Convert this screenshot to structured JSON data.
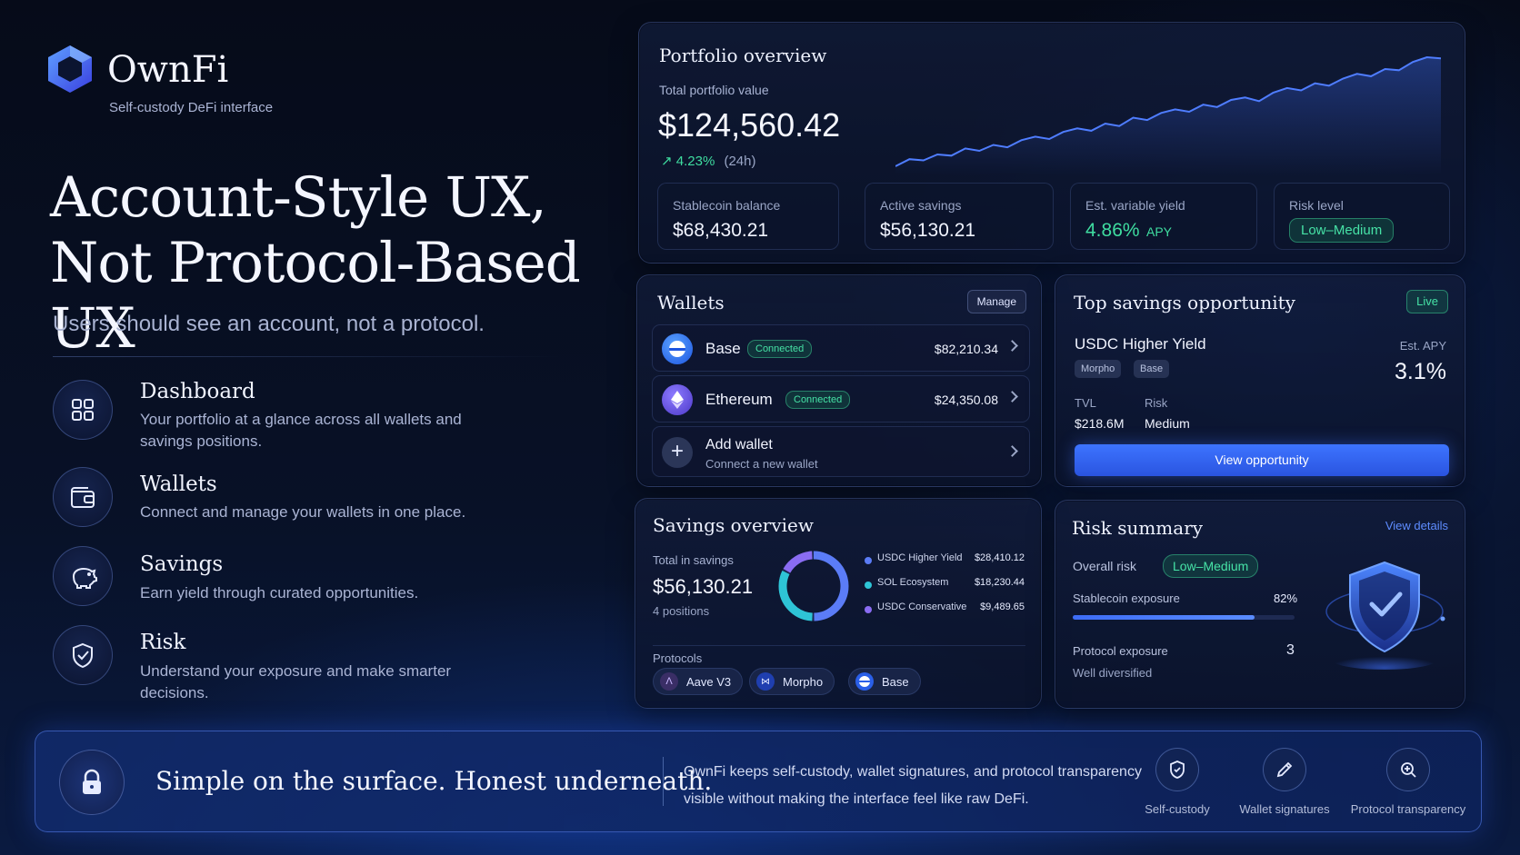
{
  "brand": {
    "name": "OwnFi",
    "subtitle": "Self-custody DeFi interface",
    "icon": "hexagon-logo-icon",
    "accent": "#3d6cf5"
  },
  "hero": {
    "headline_line1": "Account-Style UX,",
    "headline_line2": "Not Protocol-Based UX",
    "tagline": "Users should see an account, not a protocol."
  },
  "features": [
    {
      "title": "Dashboard",
      "desc": "Your portfolio at a glance across all wallets and savings positions.",
      "icon": "grid-icon"
    },
    {
      "title": "Wallets",
      "desc": "Connect and manage your wallets in one place.",
      "icon": "wallet-icon"
    },
    {
      "title": "Savings",
      "desc": "Earn yield through curated opportunities.",
      "icon": "piggy-bank-icon"
    },
    {
      "title": "Risk",
      "desc": "Understand your exposure and make smarter decisions.",
      "icon": "shield-check-icon"
    }
  ],
  "portfolio": {
    "title": "Portfolio overview",
    "total_label": "Total portfolio value",
    "total_value": "$124,560.42",
    "change": "4.23%",
    "change_period": "(24h)",
    "stats": [
      {
        "label": "Stablecoin balance",
        "value": "$68,430.21"
      },
      {
        "label": "Active savings",
        "value": "$56,130.21"
      },
      {
        "label": "Est. variable yield",
        "value": "4.86%",
        "unit": "APY"
      },
      {
        "label": "Risk level",
        "value": "Low–Medium"
      }
    ],
    "sparkline": [
      4,
      10,
      9,
      14,
      13,
      19,
      17,
      22,
      20,
      26,
      29,
      27,
      33,
      36,
      34,
      40,
      38,
      45,
      43,
      49,
      52,
      50,
      56,
      54,
      60,
      62,
      59,
      66,
      70,
      68,
      74,
      72,
      78,
      82,
      80,
      86,
      85,
      92,
      96,
      95
    ]
  },
  "wallets": {
    "title": "Wallets",
    "manage_label": "Manage",
    "items": [
      {
        "name": "Base",
        "status": "Connected",
        "balance": "$82,210.34",
        "icon": "base-logo-icon"
      },
      {
        "name": "Ethereum",
        "status": "Connected",
        "balance": "$24,350.08",
        "icon": "ethereum-logo-icon"
      }
    ],
    "add": {
      "title": "Add wallet",
      "subtitle": "Connect a new wallet",
      "icon": "plus-icon"
    }
  },
  "opportunity": {
    "title": "Top savings opportunity",
    "badge": "Live",
    "name": "USDC Higher Yield",
    "tags": [
      "Morpho",
      "Base"
    ],
    "apy_label": "Est. APY",
    "apy_value": "3.1%",
    "tvl_label": "TVL",
    "tvl_value": "$218.6M",
    "risk_label": "Risk",
    "risk_value": "Medium",
    "cta": "View opportunity"
  },
  "savings": {
    "title": "Savings overview",
    "total_label": "Total in savings",
    "total_value": "$56,130.21",
    "positions": "4 positions",
    "legend": [
      {
        "name": "USDC Higher Yield",
        "value": "$28,410.12",
        "color": "#5b7cf6"
      },
      {
        "name": "SOL Ecosystem",
        "value": "$18,230.44",
        "color": "#2ec4d6"
      },
      {
        "name": "USDC Conservative",
        "value": "$9,489.65",
        "color": "#8a6cf2"
      }
    ],
    "protocols_label": "Protocols",
    "protocols": [
      {
        "name": "Aave V3",
        "icon": "aave-logo-icon"
      },
      {
        "name": "Morpho",
        "icon": "morpho-logo-icon"
      },
      {
        "name": "Base",
        "icon": "base-logo-icon"
      }
    ]
  },
  "risk": {
    "title": "Risk summary",
    "view_details": "View details",
    "overall_label": "Overall risk",
    "overall_value": "Low–Medium",
    "stable_label": "Stablecoin exposure",
    "stable_value": "82%",
    "stable_fraction": 0.82,
    "protocol_label": "Protocol exposure",
    "protocol_value": "3",
    "protocol_note": "Well diversified",
    "icon": "shield-check-icon"
  },
  "banner": {
    "headline": "Simple on the surface. Honest underneath.",
    "body_line1": "OwnFi keeps self-custody, wallet signatures, and protocol transparency",
    "body_line2": "visible without making the interface feel like raw DeFi.",
    "icon": "lock-icon",
    "pillars": [
      {
        "label": "Self-custody",
        "icon": "shield-icon"
      },
      {
        "label": "Wallet signatures",
        "icon": "pen-icon"
      },
      {
        "label": "Protocol transparency",
        "icon": "magnifier-icon"
      }
    ]
  }
}
